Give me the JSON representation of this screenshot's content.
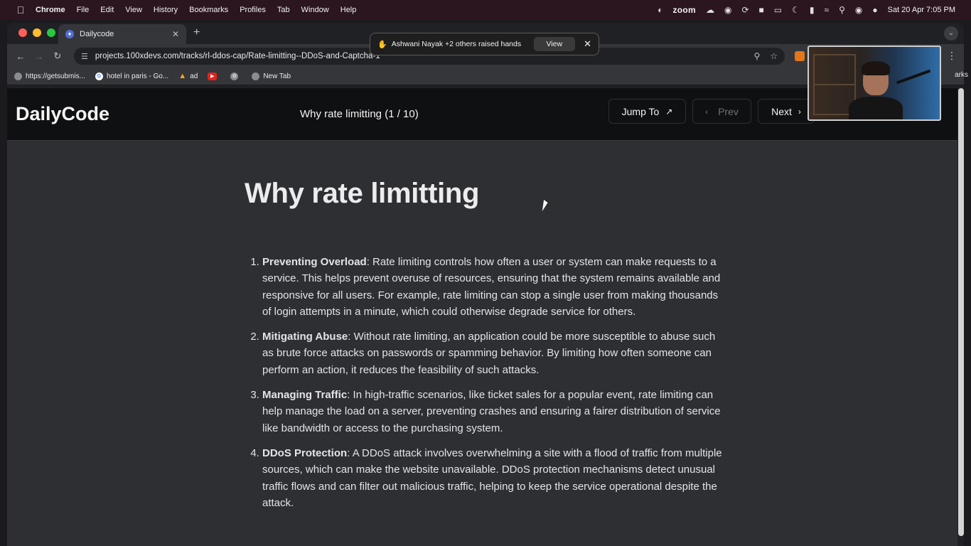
{
  "menubar": {
    "apple_icon": "apple-icon",
    "app": "Chrome",
    "items": [
      "File",
      "Edit",
      "View",
      "History",
      "Bookmarks",
      "Profiles",
      "Tab",
      "Window",
      "Help"
    ],
    "zoom_label": "zoom",
    "clock": "Sat 20 Apr  7:05 PM"
  },
  "browser": {
    "tab_title": "Dailycode",
    "url": "projects.100xdevs.com/tracks/rl-ddos-cap/Rate-limitting--DDoS-and-Captcha-1",
    "bookmarks": [
      {
        "label": "https://getsubmis...",
        "icon": "globe-icon"
      },
      {
        "label": "hotel in paris - Go...",
        "icon": "google-icon"
      },
      {
        "label": "ad",
        "icon": "fire-icon"
      },
      {
        "label": "",
        "icon": "youtube-icon"
      },
      {
        "label": "",
        "icon": "gear-icon"
      },
      {
        "label": "New Tab",
        "icon": "globe-icon"
      }
    ],
    "bookmarks_trailing": "arks"
  },
  "zoom_toast": {
    "text": "Ashwani Nayak +2 others raised hands",
    "view_label": "View"
  },
  "site": {
    "brand": "DailyCode",
    "lesson_title": "Why rate limitting (1 / 10)",
    "jump_label": "Jump To",
    "prev_label": "Prev",
    "next_label": "Next"
  },
  "article": {
    "heading": "Why rate limitting",
    "items": [
      {
        "term": "Preventing Overload",
        "text": ": Rate limiting controls how often a user or system can make requests to a service. This helps prevent overuse of resources, ensuring that the system remains available and responsive for all users. For example, rate limiting can stop a single user from making thousands of login attempts in a minute, which could otherwise degrade service for others."
      },
      {
        "term": "Mitigating Abuse",
        "text": ": Without rate limiting, an application could be more susceptible to abuse such as brute force attacks on passwords or spamming behavior. By limiting how often someone can perform an action, it reduces the feasibility of such attacks."
      },
      {
        "term": "Managing Traffic",
        "text": ": In high-traffic scenarios, like ticket sales for a popular event, rate limiting can help manage the load on a server, preventing crashes and ensuring a fairer distribution of service like bandwidth or access to the purchasing system."
      },
      {
        "term": "DDoS Protection",
        "text": ": A DDoS attack involves overwhelming a site with a flood of traffic from multiple sources, which can make the website unavailable. DDoS protection mechanisms detect unusual traffic flows and can filter out malicious traffic, helping to keep the service operational despite the attack."
      }
    ]
  }
}
